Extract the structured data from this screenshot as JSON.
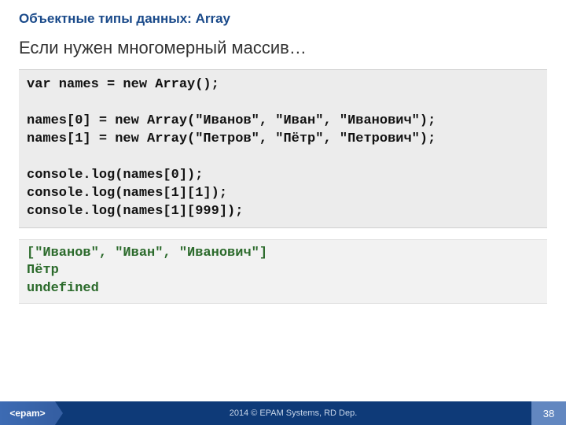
{
  "header": {
    "title": "Объектные типы данных: Array"
  },
  "subtitle": "Если нужен многомерный массив…",
  "code": "var names = new Array();\n\nnames[0] = new Array(\"Иванов\", \"Иван\", \"Иванович\");\nnames[1] = new Array(\"Петров\", \"Пётр\", \"Петрович\");\n\nconsole.log(names[0]);\nconsole.log(names[1][1]);\nconsole.log(names[1][999]);",
  "output": "[\"Иванов\", \"Иван\", \"Иванович\"]\nПётр\nundefined",
  "footer": {
    "logo": "<epam>",
    "copyright": "2014 © EPAM Systems, RD Dep.",
    "page": "38"
  }
}
